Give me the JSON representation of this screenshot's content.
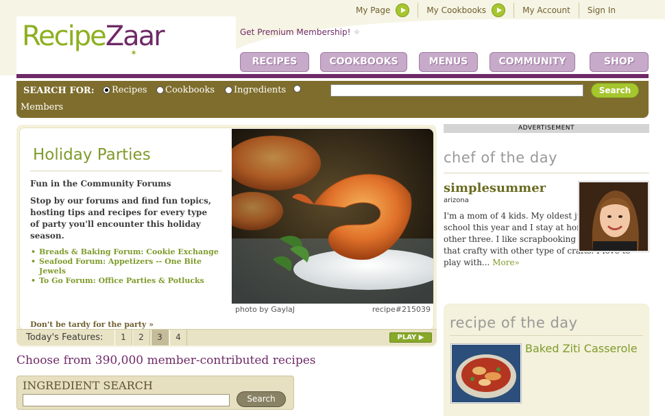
{
  "brand": {
    "logo_part1": "Recipe",
    "logo_part2": "Zaar"
  },
  "top_links": [
    {
      "label": "My Page"
    },
    {
      "label": "My Cookbooks"
    },
    {
      "label": "My Account"
    },
    {
      "label": "Sign In"
    }
  ],
  "premium": "Get Premium Membership!",
  "nav": [
    "RECIPES",
    "COOKBOOKS",
    "MENUS",
    "COMMUNITY",
    "SHOP"
  ],
  "search": {
    "label": "SEARCH FOR:",
    "options": [
      "Recipes",
      "Cookbooks",
      "Ingredients",
      "Members"
    ],
    "selected": "Recipes",
    "button": "Search",
    "value": ""
  },
  "feature": {
    "title": "Holiday Parties",
    "subtitle": "Fun in the Community Forums",
    "body": "Stop by our forums and find fun topics, hosting tips and recipes for every type of party you'll encounter this holiday season.",
    "links": [
      "Breads & Baking Forum: Cookie Exchange",
      "Seafood Forum: Appetizers -- One Bite Jewels",
      "To Go Forum: Office Parties & Potlucks"
    ],
    "more": "Don't be tardy for the party »",
    "photo_credit": "photo by GaylaJ",
    "recipe_id": "recipe#215039",
    "features_label": "Today's Features:",
    "pages": [
      "1",
      "2",
      "3",
      "4"
    ],
    "active_page": "3",
    "play": "PLAY ▶"
  },
  "choose_text": "Choose from 390,000 member-contributed recipes",
  "ingredient_search": {
    "title": "INGREDIENT SEARCH",
    "button": "Search",
    "value": ""
  },
  "ad_label": "ADVERTISEMENT",
  "chef_of_day": {
    "heading": "chef of the day",
    "name": "simplesummer",
    "location": "arizona",
    "bio": "I'm a mom of 4 kids. My oldest just started school this year and I stay at home with the other three. I like scrapbooking although I'm not that crafty with other type of crafts. I love to play with...",
    "more": "More»"
  },
  "recipe_of_day": {
    "heading": "recipe of the day",
    "name": "Baked Ziti Casserole"
  },
  "colors": {
    "brand_green": "#8db020",
    "brand_purple": "#6e2a66",
    "nav_button": "#c7a9c9",
    "search_bar": "#7e6d2c",
    "cream": "#f4f1dc"
  }
}
